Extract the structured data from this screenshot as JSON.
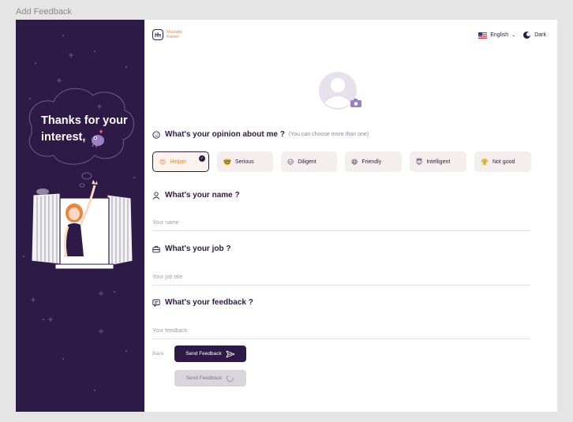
{
  "frame_title": "Add Feedback",
  "sidebar": {
    "thanks_line1": "Thanks for your",
    "thanks_line2": "interest,"
  },
  "header": {
    "logo_line1": "Mustafa",
    "logo_line2": "Kamel",
    "language": "English",
    "theme": "Dark"
  },
  "opinion": {
    "question": "What's your opinion about me ?",
    "hint": "(You can choose more than one)",
    "chips": [
      {
        "label": "Helper",
        "emoji": "😍",
        "selected": true
      },
      {
        "label": "Serious",
        "emoji": "🤓",
        "selected": false
      },
      {
        "label": "Diligent",
        "emoji": "😑",
        "selected": false
      },
      {
        "label": "Friendly",
        "emoji": "😄",
        "selected": false
      },
      {
        "label": "Intelligent",
        "emoji": "😇",
        "selected": false
      },
      {
        "label": "Not good",
        "emoji": "😤",
        "selected": false
      }
    ]
  },
  "name": {
    "question": "What's your name ?",
    "placeholder": "Your name"
  },
  "job": {
    "question": "What's your job ?",
    "placeholder": "Your job title"
  },
  "feedback": {
    "question": "What's your feedback ?",
    "placeholder": "Your feedback"
  },
  "actions": {
    "back": "Back",
    "send": "Send Feedback",
    "send_loading": "Send Feedback"
  },
  "colors": {
    "primary": "#2e1a47",
    "accent": "#f0833a",
    "chip_bg": "#f4efec"
  }
}
